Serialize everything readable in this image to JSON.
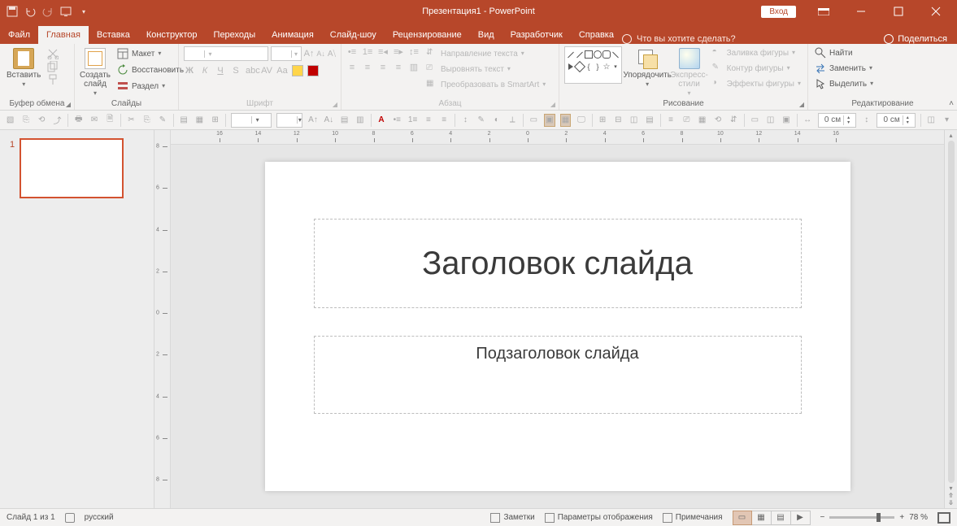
{
  "title": "Презентация1  -  PowerPoint",
  "login_button": "Вход",
  "share": {
    "label": "Поделиться"
  },
  "tabs": [
    "Файл",
    "Главная",
    "Вставка",
    "Конструктор",
    "Переходы",
    "Анимация",
    "Слайд-шоу",
    "Рецензирование",
    "Вид",
    "Разработчик",
    "Справка"
  ],
  "active_tab": "Главная",
  "tell_me": "Что вы хотите сделать?",
  "ribbon": {
    "clipboard": {
      "label": "Буфер обмена",
      "paste": "Вставить",
      "cut": "",
      "copy": "",
      "format_painter": ""
    },
    "slides": {
      "label": "Слайды",
      "new_slide": "Создать\nслайд",
      "layout": "Макет",
      "reset": "Восстановить",
      "section": "Раздел"
    },
    "font": {
      "label": "Шрифт",
      "font_name": "",
      "font_size": ""
    },
    "paragraph": {
      "label": "Абзац",
      "text_dir": "Направление текста",
      "align_text": "Выровнять текст",
      "smartart": "Преобразовать в SmartArt"
    },
    "drawing": {
      "label": "Рисование",
      "arrange": "Упорядочить",
      "quick_styles": "Экспресс-\nстили",
      "shape_fill": "Заливка фигуры",
      "shape_outline": "Контур фигуры",
      "shape_effects": "Эффекты фигуры"
    },
    "editing": {
      "label": "Редактирование",
      "find": "Найти",
      "replace": "Заменить",
      "select": "Выделить"
    }
  },
  "qat2": {
    "size1": "0 см",
    "size2": "0 см"
  },
  "h_ruler": [
    "16",
    "14",
    "12",
    "10",
    "8",
    "6",
    "4",
    "2",
    "0",
    "2",
    "4",
    "6",
    "8",
    "10",
    "12",
    "14",
    "16"
  ],
  "v_ruler": [
    "8",
    "6",
    "4",
    "2",
    "0",
    "2",
    "4",
    "6",
    "8"
  ],
  "slide": {
    "number": "1",
    "title_placeholder": "Заголовок слайда",
    "subtitle_placeholder": "Подзаголовок слайда"
  },
  "status": {
    "slide_count": "Слайд 1 из 1",
    "language": "русский",
    "notes": "Заметки",
    "display_settings": "Параметры отображения",
    "comments": "Примечания",
    "zoom": "78 %"
  }
}
